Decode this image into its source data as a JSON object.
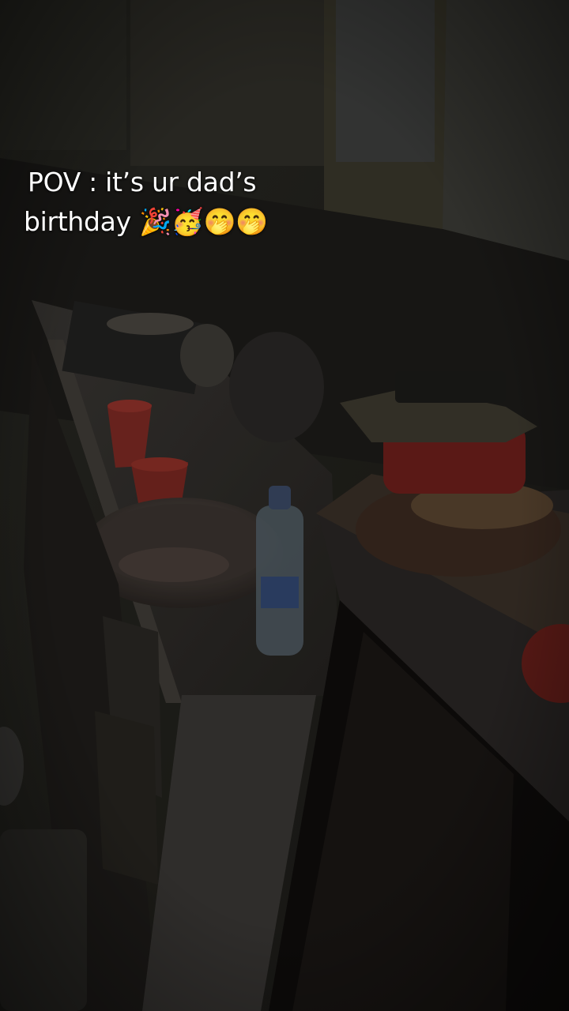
{
  "caption": {
    "line1": "POV : it’s ur dad’s",
    "line2": "birthday 🎉🥳🤭🤭"
  },
  "scene_elements": {
    "bottle_label": "",
    "colors": {
      "wall": "#1f1e1a",
      "counter": "#2e2b27",
      "red_cup": "#8a2a24",
      "cooker": "#7a1f1c"
    }
  }
}
